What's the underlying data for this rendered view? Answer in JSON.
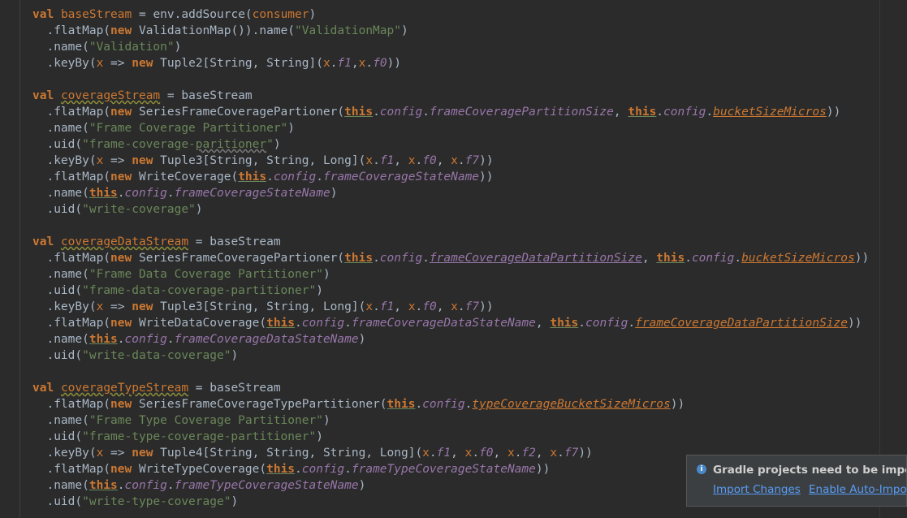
{
  "editor": {
    "language": "scala",
    "lines": [
      "val baseStream = env.addSource(consumer)",
      "  .flatMap(new ValidationMap()).name(\"ValidationMap\")",
      "  .name(\"Validation\")",
      "  .keyBy(x => new Tuple2[String, String](x.f1,x.f0))",
      "",
      "val coverageStream = baseStream",
      "  .flatMap(new SeriesFrameCoveragePartioner(this.config.frameCoveragePartitionSize, this.config.bucketSizeMicros))",
      "  .name(\"Frame Coverage Partitioner\")",
      "  .uid(\"frame-coverage-paritioner\")",
      "  .keyBy(x => new Tuple3[String, String, Long](x.f1, x.f0, x.f7))",
      "  .flatMap(new WriteCoverage(this.config.frameCoverageStateName))",
      "  .name(this.config.frameCoverageStateName)",
      "  .uid(\"write-coverage\")",
      "",
      "val coverageDataStream = baseStream",
      "  .flatMap(new SeriesFrameCoveragePartioner(this.config.frameCoverageDataPartitionSize, this.config.bucketSizeMicros))",
      "  .name(\"Frame Data Coverage Partitioner\")",
      "  .uid(\"frame-data-coverage-partitioner\")",
      "  .keyBy(x => new Tuple3[String, String, Long](x.f1, x.f0, x.f7))",
      "  .flatMap(new WriteDataCoverage(this.config.frameCoverageDataStateName, this.config.frameCoverageDataPartitionSize))",
      "  .name(this.config.frameCoverageDataStateName)",
      "  .uid(\"write-data-coverage\")",
      "",
      "val coverageTypeStream = baseStream",
      "  .flatMap(new SeriesFrameCoverageTypePartitioner(this.config.typeCoverageBucketSizeMicros))",
      "  .name(\"Frame Type Coverage Partitioner\")",
      "  .uid(\"frame-type-coverage-partitioner\")",
      "  .keyBy(x => new Tuple4[String, String, String, Long](x.f1, x.f0, x.f2, x.f7))",
      "  .flatMap(new WriteTypeCoverage(this.config.frameTypeCoverageStateName))",
      "  .name(this.config.frameTypeCoverageStateName)",
      "  .uid(\"write-type-coverage\")"
    ]
  },
  "notification": {
    "icon": "info-icon",
    "title": "Gradle projects need to be imported",
    "import_changes_label": "Import Changes",
    "enable_auto_import_label": "Enable Auto-Import"
  },
  "colors": {
    "background": "#2b2b2b",
    "keyword": "#cc7832",
    "string": "#6a8759",
    "field": "#9876aa",
    "default_text": "#a9b7c6",
    "link": "#589df6"
  }
}
